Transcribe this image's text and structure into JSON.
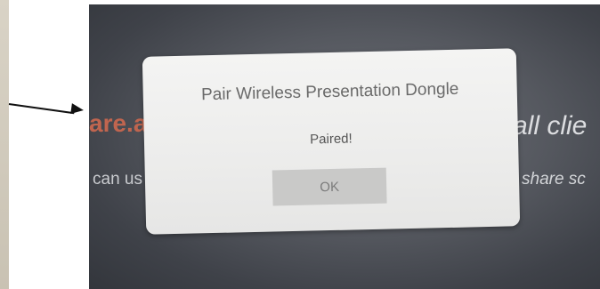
{
  "background_screen": {
    "left_title_fragment": "are.a",
    "left_subtitle_fragment": "can us",
    "right_title_fragment": "all clie",
    "right_subtitle_fragment": "share sc",
    "accent_color": "#c0654f"
  },
  "dialog": {
    "title": "Pair Wireless Presentation Dongle",
    "message": "Paired!",
    "ok_label": "OK"
  },
  "annotation": {
    "icon": "arrow-right-icon"
  }
}
